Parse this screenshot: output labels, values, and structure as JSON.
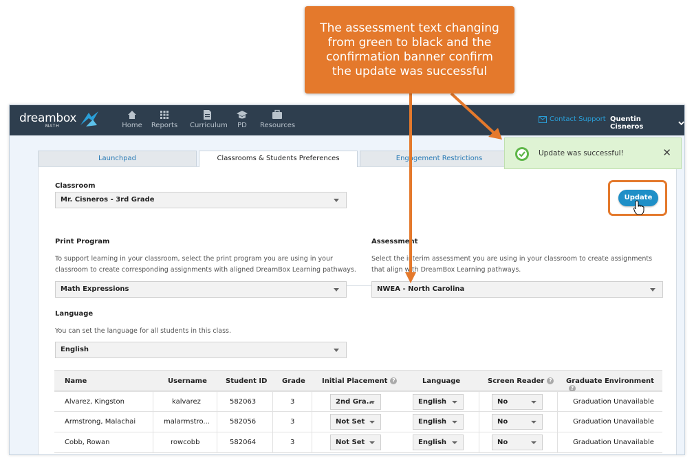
{
  "callout": {
    "text": "The assessment text changing from green to black and the confirmation banner confirm the update was successful"
  },
  "topnav": {
    "logo": "dreambox",
    "logo_sub": "MATH",
    "items": [
      {
        "label": "Home",
        "icon": "home-icon"
      },
      {
        "label": "Reports",
        "icon": "grid-icon"
      },
      {
        "label": "Curriculum",
        "icon": "document-icon"
      },
      {
        "label": "PD",
        "icon": "graduation-cap-icon"
      },
      {
        "label": "Resources",
        "icon": "briefcase-icon"
      }
    ],
    "contact": "Contact Support",
    "user": "Quentin Cisneros"
  },
  "tabs": [
    "Launchpad",
    "Classrooms & Students Preferences",
    "Engagement Restrictions"
  ],
  "toast": {
    "message": "Update was successful!",
    "close": "✕"
  },
  "form": {
    "classroom_label": "Classroom",
    "classroom_value": "Mr. Cisneros - 3rd Grade",
    "update_label": "Update",
    "print_label": "Print Program",
    "print_desc": "To support learning in your classroom, select the print program you are using in your classroom to create corresponding assignments with aligned DreamBox Learning pathways.",
    "print_value": "Math Expressions",
    "assessment_label": "Assessment",
    "assessment_desc": "Select the interim assessment you are using in your classroom to create assignments that align with DreamBox Learning pathways.",
    "assessment_value": "NWEA - North Carolina",
    "language_label": "Language",
    "language_desc": "You can set the language for all students in this class.",
    "language_value": "English"
  },
  "table": {
    "headers": [
      "Name",
      "Username",
      "Student ID",
      "Grade",
      "Initial Placement",
      "Language",
      "Screen Reader",
      "Graduate Environment"
    ],
    "rows": [
      {
        "name": "Alvarez, Kingston",
        "username": "kalvarez",
        "id": "582063",
        "grade": "3",
        "placement": "2nd Gra...",
        "language": "English",
        "reader": "No",
        "graduate": "Graduation Unavailable"
      },
      {
        "name": "Armstrong, Malachai",
        "username": "malarmstro...",
        "id": "582056",
        "grade": "3",
        "placement": "Not Set",
        "language": "English",
        "reader": "No",
        "graduate": "Graduation Unavailable"
      },
      {
        "name": "Cobb, Rowan",
        "username": "rowcobb",
        "id": "582064",
        "grade": "3",
        "placement": "Not Set",
        "language": "English",
        "reader": "No",
        "graduate": "Graduation Unavailable"
      }
    ]
  },
  "colors": {
    "accent": "#e4792c",
    "nav": "#2e3e4e",
    "button": "#1e8fc7",
    "toast": "#dff3d4"
  }
}
